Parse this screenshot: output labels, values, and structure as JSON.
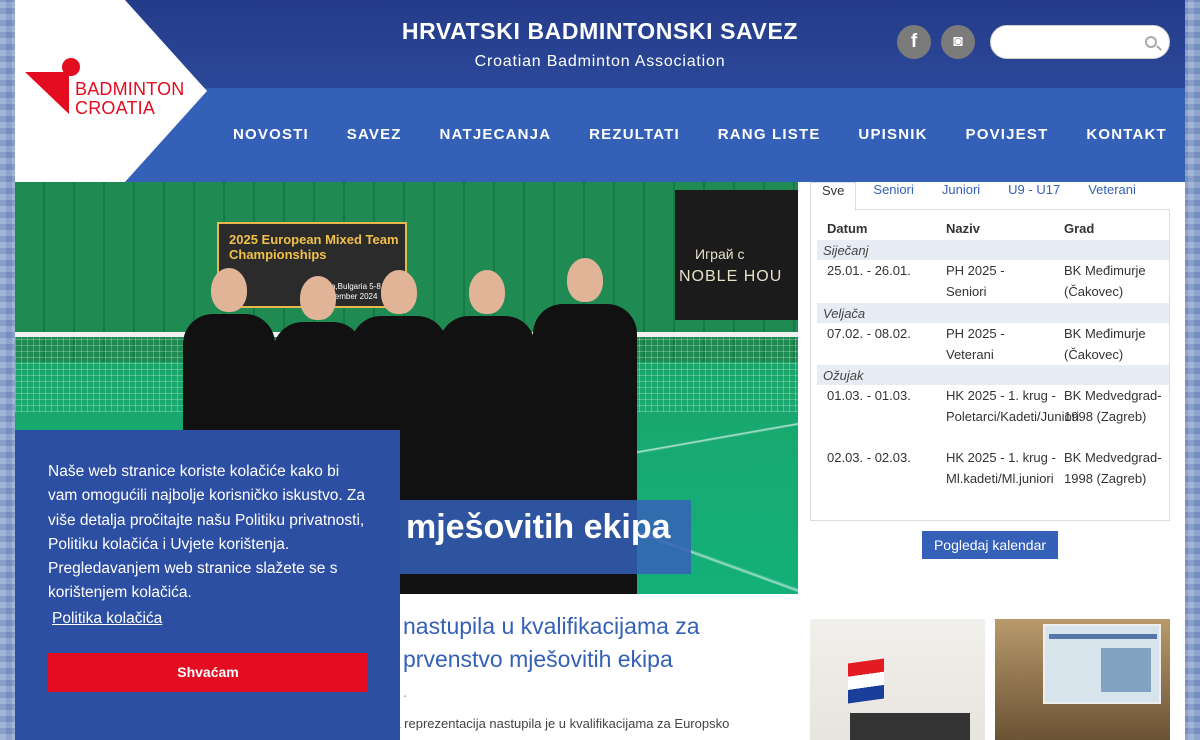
{
  "header": {
    "title": "HRVATSKI BADMINTONSKI SAVEZ",
    "subtitle": "Croatian Badminton Association",
    "logo_line1": "BADMINTON",
    "logo_line2": "CROATIA",
    "social": [
      {
        "name": "facebook-icon",
        "glyph": "f"
      },
      {
        "name": "instagram-icon",
        "glyph": "◙"
      }
    ],
    "search": {
      "placeholder": "",
      "value": ""
    }
  },
  "nav": {
    "items": [
      "NOVOSTI",
      "SAVEZ",
      "NATJECANJA",
      "REZULTATI",
      "RANG LISTE",
      "UPISNIK",
      "POVIJEST",
      "KONTAKT"
    ]
  },
  "hero": {
    "caption": "mješovitih ekipa",
    "board_text": "2025 European Mixed Team Championships",
    "board_small": "Sofia,Bulgaria 5-8 December 2024",
    "sponsor_1": "Играй с",
    "sponsor_2": "NOBLE HOU"
  },
  "article": {
    "title": "nastupila u kvalifikacijama za prvenstvo mješovitih ekipa",
    "date": ".",
    "excerpt": "Hrvatska seniorska reprezentacija nastupila je u kvalifikacijama za Europsko"
  },
  "calendar": {
    "tabs": [
      "Sve",
      "Seniori",
      "Juniori",
      "U9 - U17",
      "Veterani"
    ],
    "active_tab": "Sve",
    "headers": {
      "date": "Datum",
      "name": "Naziv",
      "city": "Grad"
    },
    "months": [
      {
        "label": "Siječanj",
        "events": [
          {
            "date": "25.01. - 26.01.",
            "name": "PH 2025 - Seniori",
            "city": "BK Međimurje (Čakovec)"
          }
        ]
      },
      {
        "label": "Veljača",
        "events": [
          {
            "date": "07.02. - 08.02.",
            "name": "PH 2025 - Veterani",
            "city": "BK Međimurje (Čakovec)"
          }
        ]
      },
      {
        "label": "Ožujak",
        "events": [
          {
            "date": "01.03. - 01.03.",
            "name": "HK 2025 - 1. krug - Poletarci/Kadeti/Juniori",
            "city": "BK Medvedgrad-1998 (Zagreb)"
          },
          {
            "date": "02.03. - 02.03.",
            "name": "HK 2025 - 1. krug - Ml.kadeti/Ml.juniori",
            "city": "BK Medvedgrad-1998 (Zagreb)"
          }
        ]
      }
    ],
    "button": "Pogledaj kalendar"
  },
  "cookie": {
    "text": "Naše web stranice koriste kolačiće kako bi vam omogućili najbolje korisničko iskustvo. Za više detalja pročitajte našu Politiku privatnosti, Politiku kolačića i Uvjete korištenja. Pregledavanjem web stranice slažete se s korištenjem kolačića.",
    "link": "Politika kolačića",
    "button": "Shvaćam"
  },
  "colors": {
    "header_dark": "#243c8a",
    "nav_blue": "#3560b8",
    "brand_red": "#e30c20"
  }
}
